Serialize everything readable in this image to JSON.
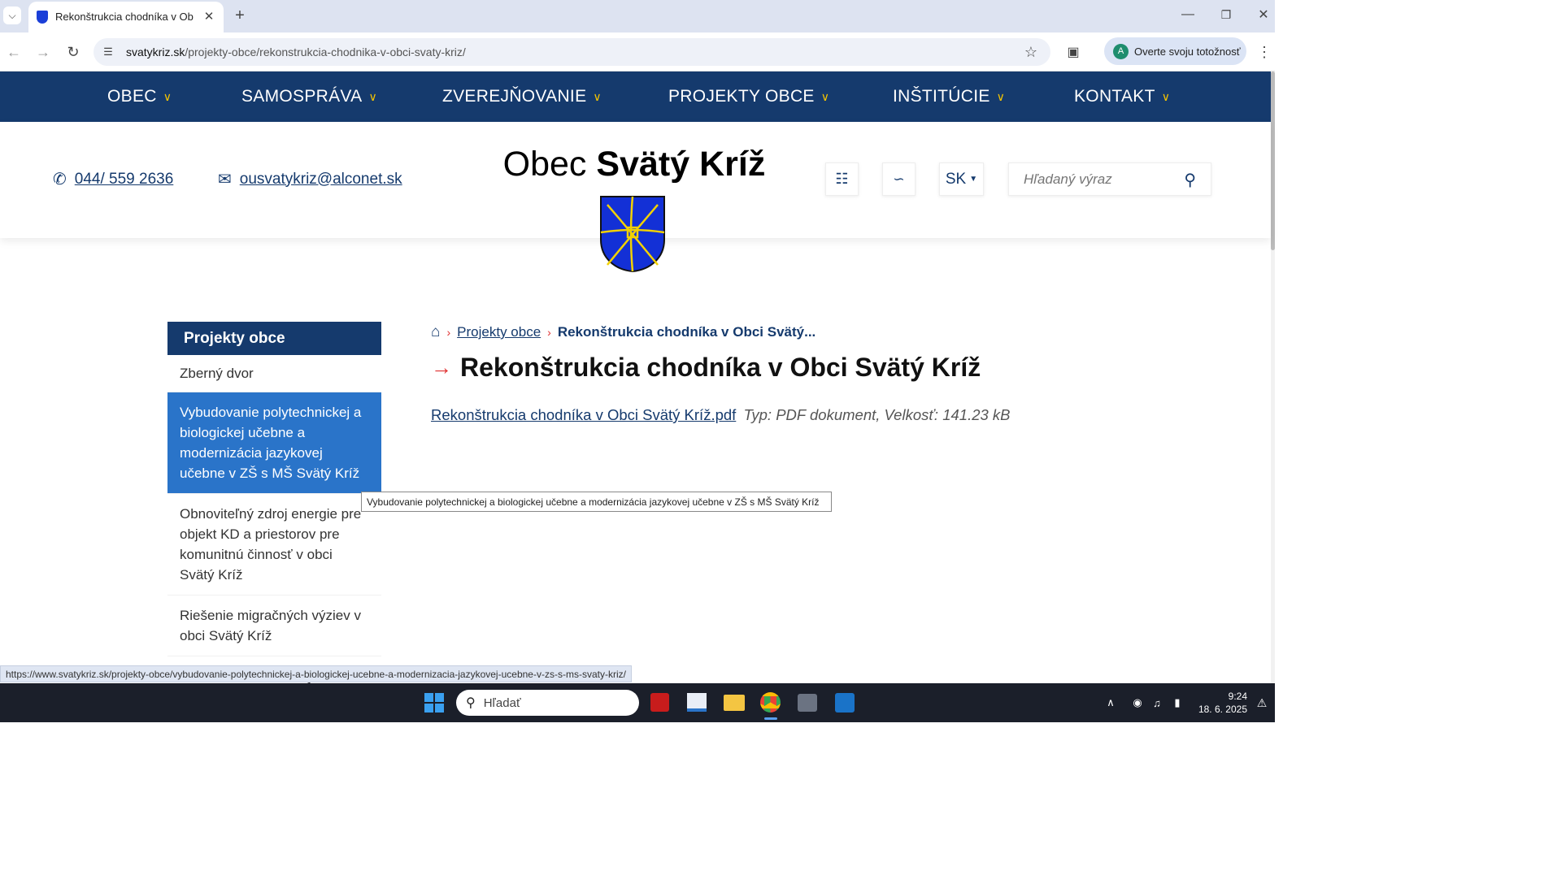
{
  "browser": {
    "tab_title": "Rekonštrukcia chodníka v Obci",
    "url_domain": "svatykriz.sk",
    "url_path": "/projekty-obce/rekonstrukcia-chodnika-v-obci-svaty-kriz/",
    "profile_label": "Overte svoju totožnosť",
    "profile_initial": "A"
  },
  "nav": {
    "items": [
      "OBEC",
      "SAMOSPRÁVA",
      "ZVEREJŇOVANIE",
      "PROJEKTY OBCE",
      "INŠTITÚCIE",
      "KONTAKT"
    ]
  },
  "header": {
    "phone": "044/ 559 2636",
    "email": "ousvatykriz@alconet.sk",
    "title_prefix": "Obec",
    "title_bold": "Svätý Kríž",
    "lang": "SK",
    "search_placeholder": "Hľadaný výraz"
  },
  "sidebar": {
    "heading": "Projekty obce",
    "items": [
      {
        "label": "Zberný dvor"
      },
      {
        "label": "Vybudovanie polytechnickej a biologickej učebne a modernizácia jazykovej učebne v ZŠ s MŠ Svätý Kríž"
      },
      {
        "label": "Obnoviteľný zdroj energie pre objekt KD a priestorov pre komunitnú činnosť v obci Svätý Kríž"
      },
      {
        "label": "Riešenie migračných výziev v obci Svätý Kríž"
      },
      {
        "label": "Rozšírenie inžinierskych sietí"
      }
    ]
  },
  "breadcrumb": {
    "link": "Projekty obce",
    "current": "Rekonštrukcia chodníka v Obci Svätý..."
  },
  "main": {
    "heading": "Rekonštrukcia chodníka v Obci Svätý Kríž",
    "file_link": "Rekonštrukcia chodníka v Obci Svätý Kríž.pdf",
    "file_meta": "Typ: PDF dokument, Velkosť: 141.23 kB"
  },
  "tooltip": "Vybudovanie polytechnickej a biologickej učebne a modernizácia jazykovej učebne v ZŠ s MŠ Svätý Kríž",
  "statusbar": "https://www.svatykriz.sk/projekty-obce/vybudovanie-polytechnickej-a-biologickej-ucebne-a-modernizacia-jazykovej-ucebne-v-zs-s-ms-svaty-kriz/",
  "taskbar": {
    "search_placeholder": "Hľadať",
    "time": "9:24",
    "date": "18. 6. 2025"
  },
  "colors": {
    "nav_bg": "#153a6d",
    "accent_yellow": "#f5c400",
    "active_item": "#2a74c9",
    "arrow_red": "#e03131"
  }
}
